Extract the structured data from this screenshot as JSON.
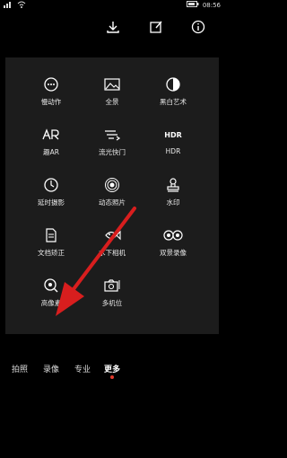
{
  "status": {
    "signal": "ııl",
    "wifi": "wifi",
    "battery": "▮",
    "time": "08:56"
  },
  "top_icons": [
    "download-icon",
    "edit-icon",
    "info-icon"
  ],
  "modes": [
    {
      "label": "慢动作",
      "icon": "slowmo-icon"
    },
    {
      "label": "全景",
      "icon": "panorama-icon"
    },
    {
      "label": "黑白艺术",
      "icon": "monochrome-icon"
    },
    {
      "label": "趣AR",
      "icon": "ar-icon"
    },
    {
      "label": "流光快门",
      "icon": "light-trail-icon"
    },
    {
      "label": "HDR",
      "icon": "hdr-icon",
      "icon_text": "HDR"
    },
    {
      "label": "延时摄影",
      "icon": "timelapse-icon"
    },
    {
      "label": "动态照片",
      "icon": "moving-photo-icon"
    },
    {
      "label": "水印",
      "icon": "watermark-icon"
    },
    {
      "label": "文档矫正",
      "icon": "document-scan-icon"
    },
    {
      "label": "水下相机",
      "icon": "underwater-icon"
    },
    {
      "label": "双景录像",
      "icon": "dual-view-icon"
    },
    {
      "label": "高像素",
      "icon": "high-res-icon"
    },
    {
      "label": "多机位",
      "icon": "multi-camera-icon"
    }
  ],
  "tabs": [
    {
      "label": "拍照",
      "active": false
    },
    {
      "label": "录像",
      "active": false
    },
    {
      "label": "专业",
      "active": false
    },
    {
      "label": "更多",
      "active": true
    }
  ],
  "colors": {
    "panel": "#1c1c1c",
    "accent": "#e23a2c",
    "arrow": "#d81e1e"
  }
}
